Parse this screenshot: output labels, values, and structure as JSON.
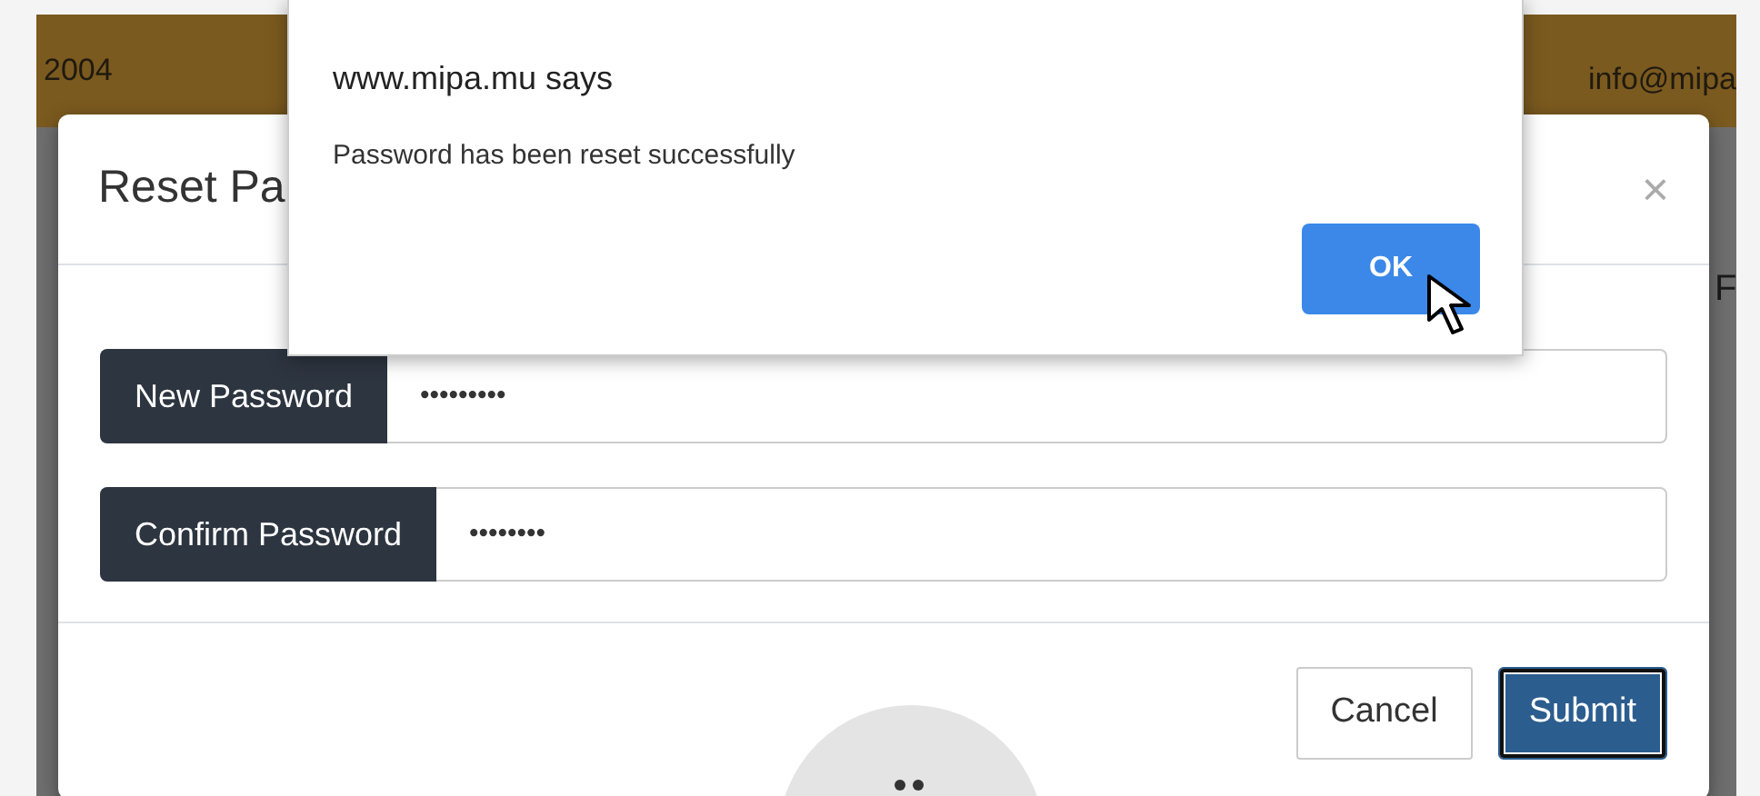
{
  "page": {
    "topbar": {
      "left_text": "2004",
      "right_text": "info@mipa"
    },
    "side_text": "F"
  },
  "modal": {
    "title": "Reset Pa",
    "close": "×",
    "fields": [
      {
        "label": "New Password",
        "value": "•••••••••"
      },
      {
        "label": "Confirm Password",
        "value": "••••••••"
      }
    ],
    "buttons": [
      {
        "label": "Cancel",
        "kind": "secondary",
        "focused": false
      },
      {
        "label": "Submit",
        "kind": "primary",
        "focused": true
      }
    ]
  },
  "alert": {
    "title": "www.mipa.mu says",
    "message": "Password has been reset successfully",
    "button": "OK"
  }
}
